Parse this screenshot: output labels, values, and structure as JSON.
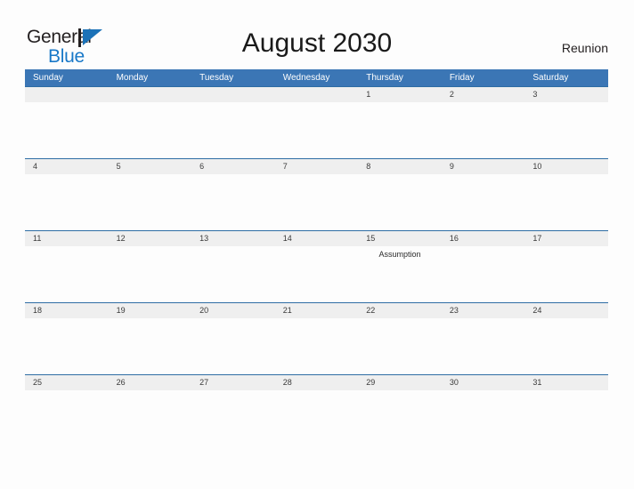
{
  "brand": {
    "name_part1": "General",
    "name_part2": "Blue",
    "mark_icon": "triangle-flag-icon",
    "color_blue": "#1878c8",
    "color_dark": "#231f20"
  },
  "header": {
    "month_title": "August 2030",
    "region": "Reunion"
  },
  "calendar": {
    "header_color": "#3b76b5",
    "row_border_color": "#2e6da4",
    "date_band_color": "#efefef",
    "weekdays": [
      "Sunday",
      "Monday",
      "Tuesday",
      "Wednesday",
      "Thursday",
      "Friday",
      "Saturday"
    ],
    "weeks": [
      {
        "dates": [
          "",
          "",
          "",
          "",
          "1",
          "2",
          "3"
        ],
        "events": [
          "",
          "",
          "",
          "",
          "",
          "",
          ""
        ]
      },
      {
        "dates": [
          "4",
          "5",
          "6",
          "7",
          "8",
          "9",
          "10"
        ],
        "events": [
          "",
          "",
          "",
          "",
          "",
          "",
          ""
        ]
      },
      {
        "dates": [
          "11",
          "12",
          "13",
          "14",
          "15",
          "16",
          "17"
        ],
        "events": [
          "",
          "",
          "",
          "",
          "Assumption",
          "",
          ""
        ]
      },
      {
        "dates": [
          "18",
          "19",
          "20",
          "21",
          "22",
          "23",
          "24"
        ],
        "events": [
          "",
          "",
          "",
          "",
          "",
          "",
          ""
        ]
      },
      {
        "dates": [
          "25",
          "26",
          "27",
          "28",
          "29",
          "30",
          "31"
        ],
        "events": [
          "",
          "",
          "",
          "",
          "",
          "",
          ""
        ]
      }
    ]
  }
}
